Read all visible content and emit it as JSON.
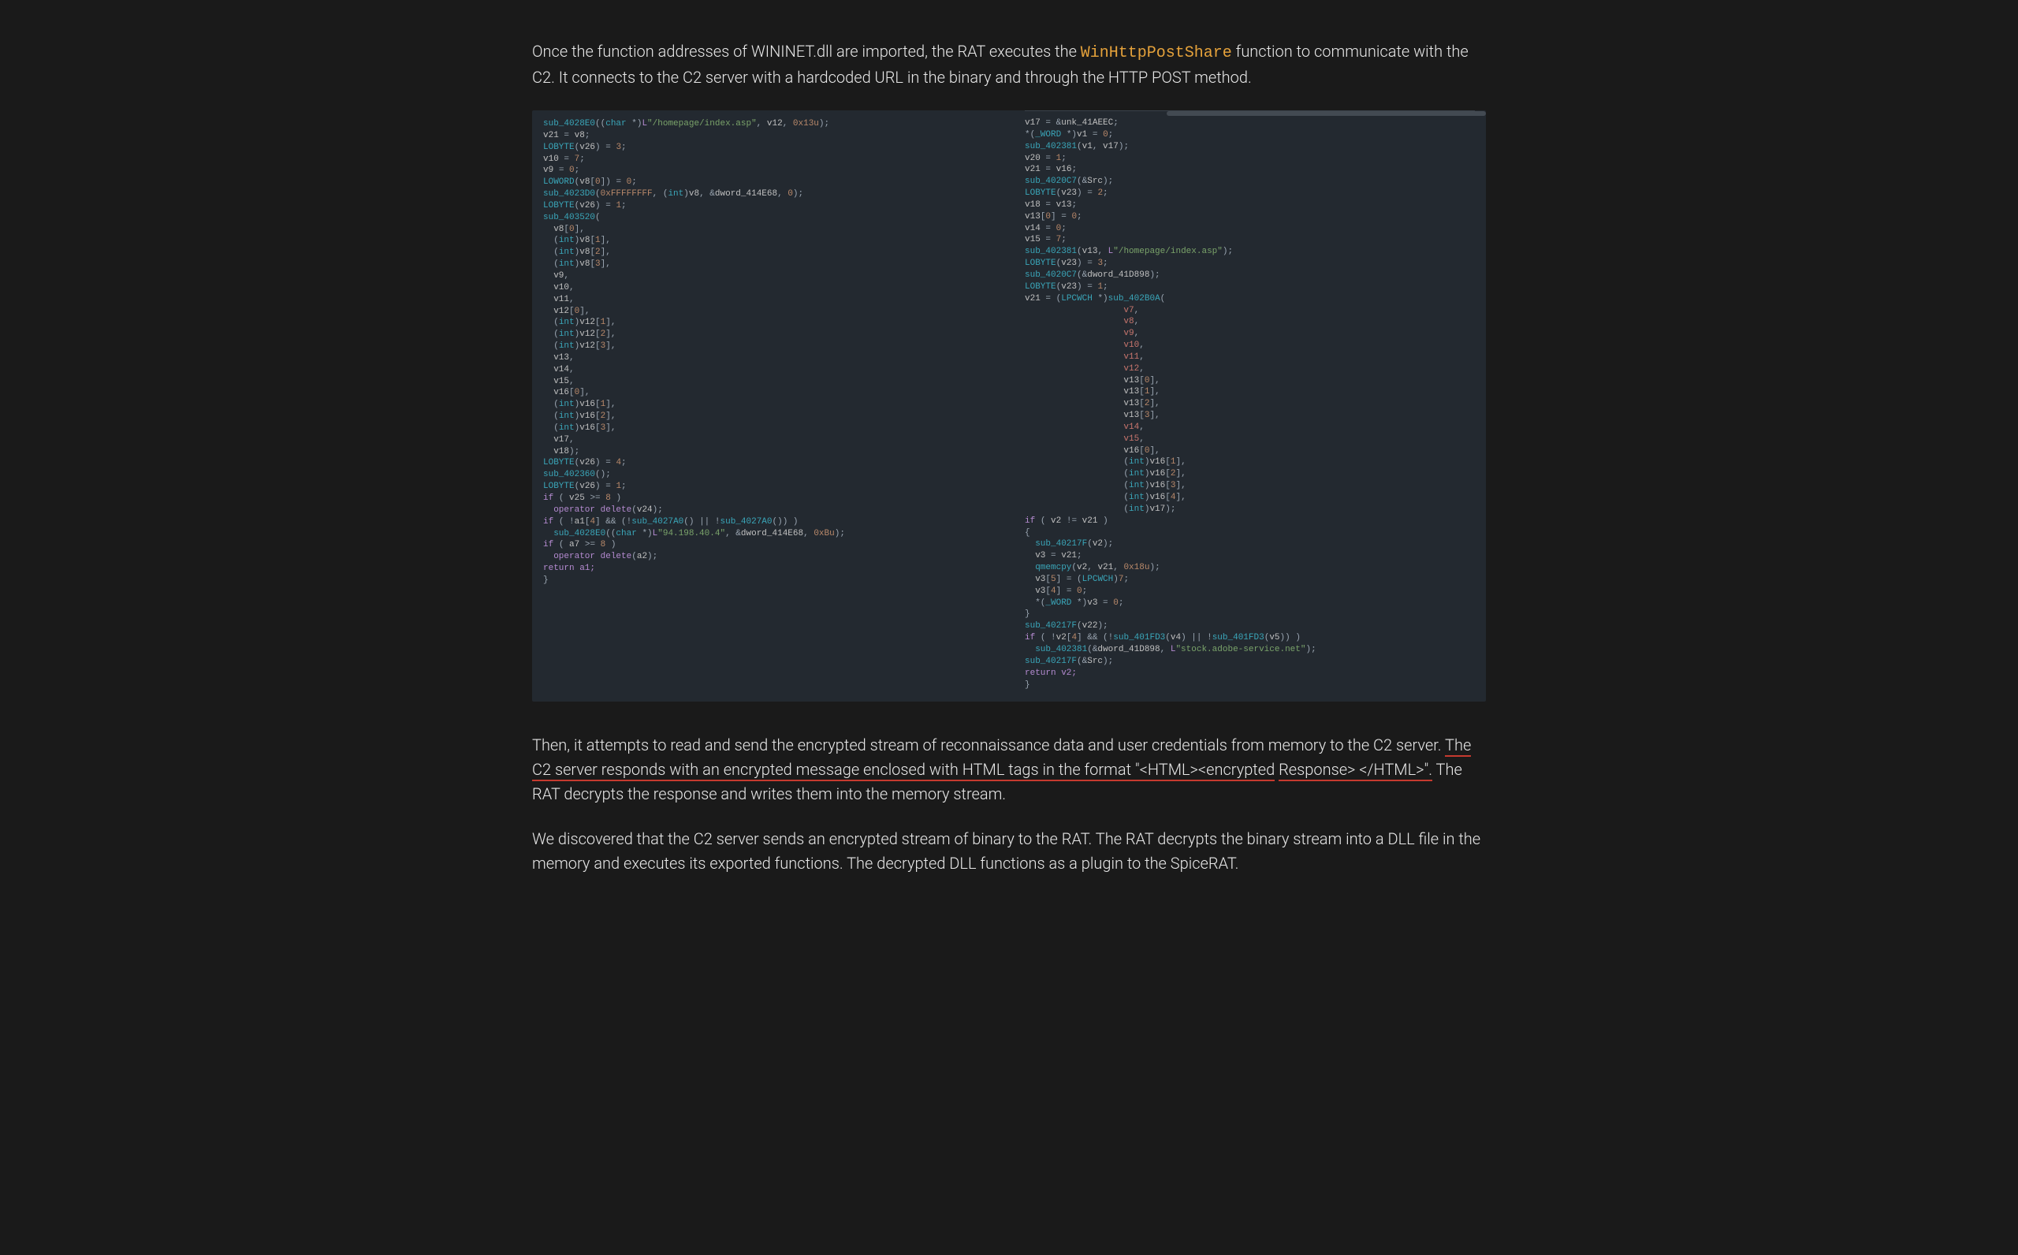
{
  "paragraphs": {
    "p1_before": "Once the function addresses of WININET.dll are imported, the RAT executes the ",
    "p1_code": "WinHttpPostShare",
    "p1_after": " function to communicate with the C2. It connects to the C2 server with a hardcoded URL in the binary and through the HTTP POST method.",
    "p2_before": "Then, it attempts to read and send the encrypted stream of reconnaissance data and user credentials from memory to the C2 server. ",
    "p2_u1": "The C2 server responds with an encrypted message enclosed with HTML tags in the format \"<HTML><encrypted",
    "p2_break": " ",
    "p2_u2": "Response> </HTML>\".",
    "p2_after": " The RAT decrypts the response and writes them into the memory stream.",
    "p3": "We discovered that the C2 server sends an encrypted stream of binary to the RAT. The RAT decrypts the binary stream into a DLL file in the memory and executes its exported functions. The decrypted DLL functions as a plugin to the SpiceRAT."
  },
  "code_tokens": {
    "homepage_url": "\"/homepage/index.asp\"",
    "ip": "\"94.198.40.4\"",
    "domain": "\"stock.adobe-service.net\"",
    "hex13u": "0x13u",
    "hex18u": "0x18u",
    "hexBu": "0xBu",
    "ffffffff": "0xFFFFFFFF",
    "return_a1": "return a1;",
    "return_v2": "return v2;"
  },
  "colors": {
    "accent": "#e5a23b",
    "underline": "#c63a2f",
    "bg": "#1a1a1a",
    "code_bg": "#232930"
  }
}
